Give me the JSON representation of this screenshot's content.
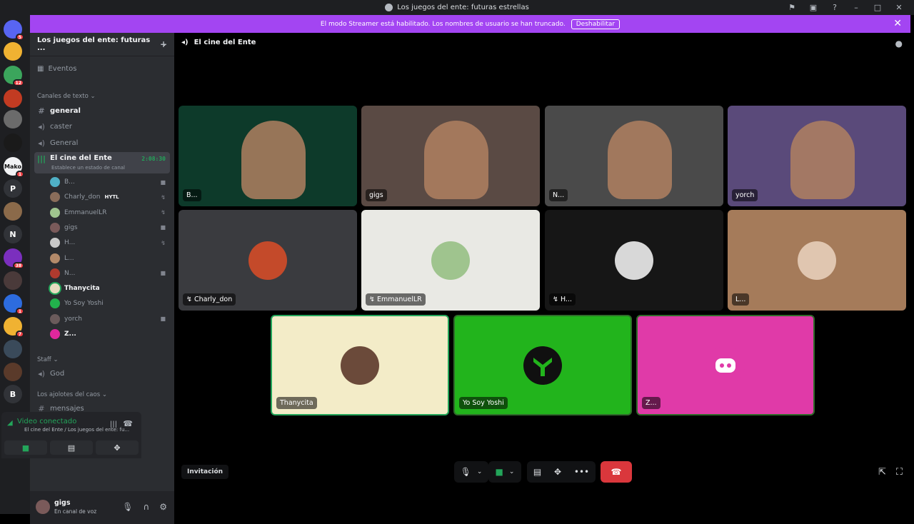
{
  "window": {
    "title": "Los juegos del ente: futuras estrellas"
  },
  "banner": {
    "text": "El modo Streamer está habilitado. Los nombres de usuario se han truncado.",
    "button": "Deshabilitar"
  },
  "guilds": [
    {
      "badge": "5",
      "color": "#5865f2",
      "label": ""
    },
    {
      "badge": "",
      "color": "#f0b232",
      "label": ""
    },
    {
      "badge": "12",
      "color": "#3ba55c",
      "label": ""
    },
    {
      "badge": "",
      "color": "#c23b22",
      "label": ""
    },
    {
      "badge": "",
      "color": "#6b6b6b",
      "label": ""
    },
    {
      "badge": "",
      "color": "#1a1a1a",
      "label": ""
    },
    {
      "badge": "1",
      "color": "#f2f3f5",
      "label": "Mako"
    },
    {
      "badge": "",
      "color": "#313338",
      "label": "P"
    },
    {
      "badge": "",
      "color": "#8b6a4a",
      "label": ""
    },
    {
      "badge": "",
      "color": "#313338",
      "label": "N"
    },
    {
      "badge": "38",
      "color": "#7b2fbe",
      "label": ""
    },
    {
      "badge": "",
      "color": "#4a3a3a",
      "label": ""
    },
    {
      "badge": "1",
      "color": "#2d6cdf",
      "label": ""
    },
    {
      "badge": "7",
      "color": "#f0b232",
      "label": ""
    },
    {
      "badge": "",
      "color": "#3a4a5a",
      "label": ""
    },
    {
      "badge": "",
      "color": "#5a3a2a",
      "label": ""
    },
    {
      "badge": "",
      "color": "#313338",
      "label": "B"
    }
  ],
  "sidebar": {
    "server_name": "Los juegos del ente: futuras ...",
    "events": "Eventos",
    "cat_text": "Canales de texto",
    "ch_general": "general",
    "ch_caster": "caster",
    "ch_General": "General",
    "ch_cine": "El cine del Ente",
    "cine_timer": "2:08:30",
    "cine_status": "Establece un estado de canal",
    "voice_users": [
      {
        "name": "B...",
        "color": "#4fb0c6",
        "tag": ""
      },
      {
        "name": "Charly_don",
        "color": "#8a6d5a",
        "tag": "HYTL"
      },
      {
        "name": "EmmanuelLR",
        "color": "#9fc48e",
        "tag": ""
      },
      {
        "name": "gigs",
        "color": "#7a5a5a",
        "tag": ""
      },
      {
        "name": "H...",
        "color": "#c9c9c9",
        "tag": ""
      },
      {
        "name": "L...",
        "color": "#b38a6a",
        "tag": ""
      },
      {
        "name": "N...",
        "color": "#b03a2e",
        "tag": ""
      },
      {
        "name": "Thanycita",
        "color": "#e8dcc0",
        "tag": ""
      },
      {
        "name": "Yo Soy Yoshi",
        "color": "#22b14c",
        "tag": ""
      },
      {
        "name": "yorch",
        "color": "#6b5b5b",
        "tag": ""
      },
      {
        "name": "Z...",
        "color": "#e0279d",
        "tag": ""
      }
    ],
    "cat_staff": "Staff",
    "ch_god": "God",
    "cat_ajolotes": "Los ajolotes del caos",
    "ch_mensajes": "mensajes"
  },
  "rtc": {
    "status": "Video conectado",
    "location": "El cine del Ente / Los juegos del ente: fu..."
  },
  "user": {
    "name": "gigs",
    "status": "En canal de voz"
  },
  "main": {
    "channel": "El cine del Ente",
    "invite": "Invitación"
  },
  "tiles": [
    {
      "name": "B...",
      "bg": "#0d3a2a",
      "video": true
    },
    {
      "name": "gigs",
      "bg": "#5a4a44",
      "video": true
    },
    {
      "name": "N...",
      "bg": "#4a4a4a",
      "video": true
    },
    {
      "name": "yorch",
      "bg": "#5a4a7a",
      "video": true
    },
    {
      "name": "Charly_don",
      "bg": "#3a3b3f",
      "video": false,
      "av": "#c44a2a",
      "muted": true
    },
    {
      "name": "EmmanuelLR",
      "bg": "#e9e9e4",
      "video": false,
      "av": "#9fc48e",
      "muted": true
    },
    {
      "name": "H...",
      "bg": "#161616",
      "video": false,
      "av": "#d8d8d8",
      "muted": true
    },
    {
      "name": "L...",
      "bg": "#a57b5a",
      "video": false,
      "av": "#e0c6b0",
      "muted": false
    },
    {
      "name": "Thanycita",
      "bg": "#f3ecc8",
      "video": false,
      "av": "#6b4a3a",
      "muted": false
    },
    {
      "name": "Yo Soy Yoshi",
      "bg": "#22b41c",
      "video": false,
      "av": "#101010",
      "muted": false
    },
    {
      "name": "Z...",
      "bg": "#e03aa8",
      "video": false,
      "av": "#e03aa8",
      "muted": false
    }
  ]
}
